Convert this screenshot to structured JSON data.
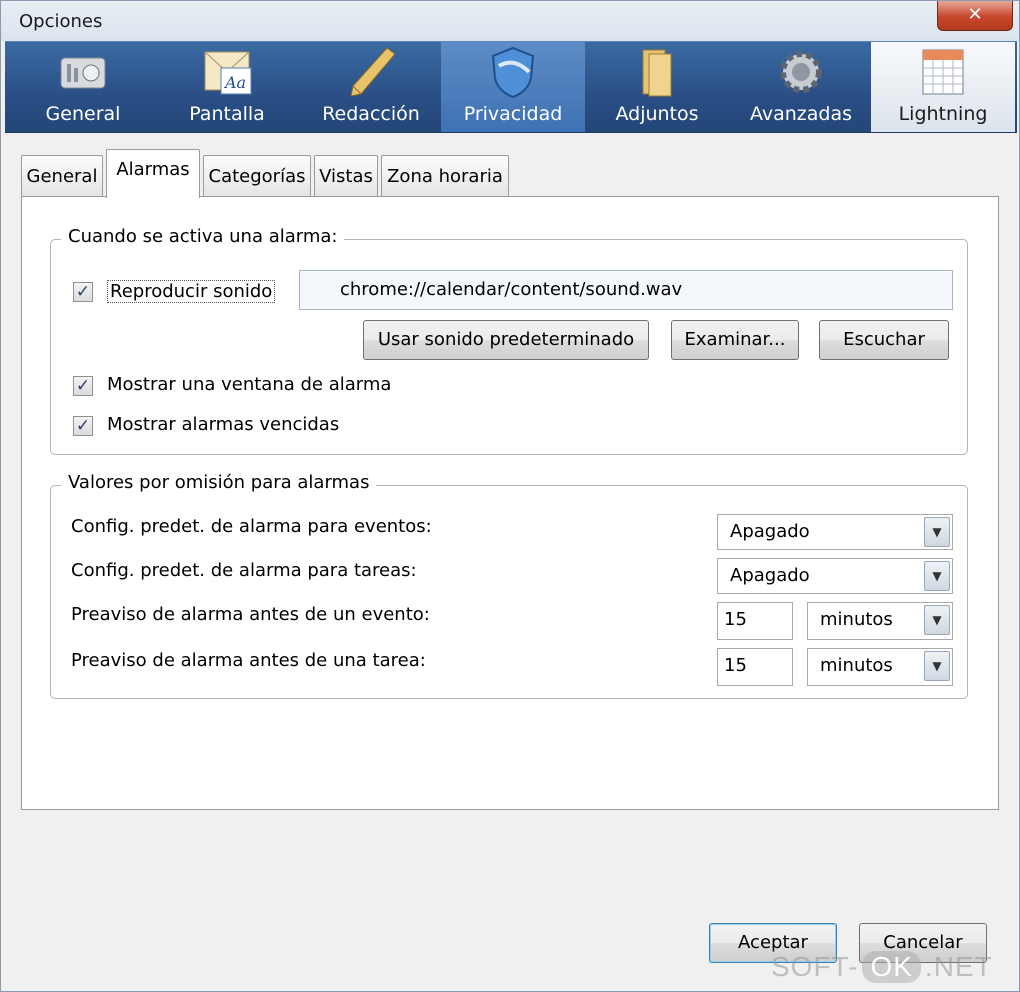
{
  "window": {
    "title": "Opciones",
    "close_glyph": "✕"
  },
  "toolbar": {
    "panes": [
      {
        "label": "General",
        "icon": "general-icon"
      },
      {
        "label": "Pantalla",
        "icon": "display-icon"
      },
      {
        "label": "Redacción",
        "icon": "compose-icon"
      },
      {
        "label": "Privacidad",
        "icon": "privacy-icon"
      },
      {
        "label": "Adjuntos",
        "icon": "attachments-icon"
      },
      {
        "label": "Avanzadas",
        "icon": "advanced-icon"
      },
      {
        "label": "Lightning",
        "icon": "calendar-icon"
      }
    ],
    "selected": "Privacidad"
  },
  "tabs": [
    "General",
    "Alarmas",
    "Categorías",
    "Vistas",
    "Zona horaria"
  ],
  "active_tab": "Alarmas",
  "alarm_group": {
    "legend": "Cuando se activa una alarma:",
    "play_sound_label": "Reproducir sonido",
    "play_sound_checked": true,
    "sound_path": "chrome://calendar/content/sound.wav",
    "default_sound_button": "Usar sonido predeterminado",
    "browse_button": "Examinar...",
    "listen_button": "Escuchar",
    "show_window_label": "Mostrar una ventana de alarma",
    "show_window_checked": true,
    "show_missed_label": "Mostrar alarmas vencidas",
    "show_missed_checked": true,
    "check_glyph": "✓"
  },
  "defaults_group": {
    "legend": "Valores por omisión para alarmas",
    "event_default_label": "Config. predet. de alarma para eventos:",
    "event_default_value": "Apagado",
    "task_default_label": "Config. predet. de alarma para tareas:",
    "task_default_value": "Apagado",
    "event_reminder_label": "Preaviso de alarma antes de un evento:",
    "event_reminder_value": "15",
    "event_reminder_unit": "minutos",
    "task_reminder_label": "Preaviso de alarma antes de una tarea:",
    "task_reminder_value": "15",
    "task_reminder_unit": "minutos",
    "arrow_glyph": "▼"
  },
  "footer": {
    "ok_button": "Aceptar",
    "cancel_button": "Cancelar"
  },
  "watermark": {
    "left": "SOFT-",
    "mid": "OK",
    "right": ".NET"
  }
}
